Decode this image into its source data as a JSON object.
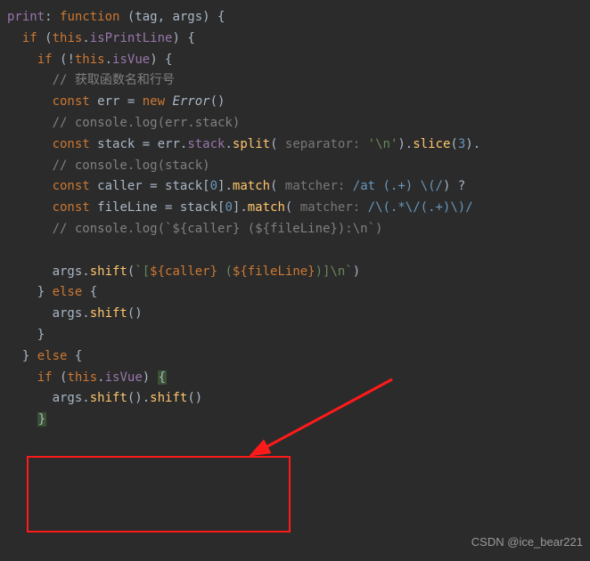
{
  "code": {
    "l1a": "print",
    "l1b": ": ",
    "l1c": "function ",
    "l1d": "(tag, args) {",
    "l2a": "  if ",
    "l2b": "(",
    "l2c": "this",
    "l2d": ".",
    "l2e": "isPrintLine",
    "l2f": ") {",
    "l3a": "    if ",
    "l3b": "(!",
    "l3c": "this",
    "l3d": ".",
    "l3e": "isVue",
    "l3f": ") {",
    "l4a": "      // 获取函数名和行号",
    "l5a": "      const ",
    "l5b": "err = ",
    "l5c": "new ",
    "l5d": "Error",
    "l5e": "()",
    "l6a": "      // console.log(err.stack)",
    "l7a": "      const ",
    "l7b": "stack = err.",
    "l7c": "stack",
    "l7d": ".",
    "l7e": "split",
    "l7f": "(",
    "l7g": " separator: ",
    "l7h": "'\\n'",
    "l7i": ").",
    "l7j": "slice",
    "l7k": "(",
    "l7l": "3",
    "l7m": ").",
    "l8a": "      // console.log(stack)",
    "l9a": "      const ",
    "l9b": "caller = stack[",
    "l9c": "0",
    "l9d": "].",
    "l9e": "match",
    "l9f": "(",
    "l9g": " matcher: ",
    "l9h": "/at (.+) \\(/",
    "l9i": ") ?",
    "l10a": "      const ",
    "l10b": "fileLine = stack[",
    "l10c": "0",
    "l10d": "].",
    "l10e": "match",
    "l10f": "(",
    "l10g": " matcher: ",
    "l10h": "/\\(.*\\/(.+)\\)/",
    "l11a": "      // console.log(`${caller} (${fileLine}):\\n`)",
    "l12a": "",
    "l13a": "      args.",
    "l13b": "shift",
    "l13c": "(",
    "l13d": "`[",
    "l13e": "${caller}",
    "l13f": " (",
    "l13g": "${fileLine}",
    "l13h": ")]\\n`",
    "l13i": ")",
    "l14a": "    } ",
    "l14b": "else ",
    "l14c": "{",
    "l15a": "      args.",
    "l15b": "shift",
    "l15c": "()",
    "l16a": "    }",
    "l17a": "  } ",
    "l17b": "else ",
    "l17c": "{",
    "l18a": "    if ",
    "l18b": "(",
    "l18c": "this",
    "l18d": ".",
    "l18e": "isVue",
    "l18f": ") ",
    "l18g": "{",
    "l19a": "      args.",
    "l19b": "shift",
    "l19c": "().",
    "l19d": "shift",
    "l19e": "()",
    "l20a": "    ",
    "l20b": "}"
  },
  "watermark": "CSDN @ice_bear221"
}
